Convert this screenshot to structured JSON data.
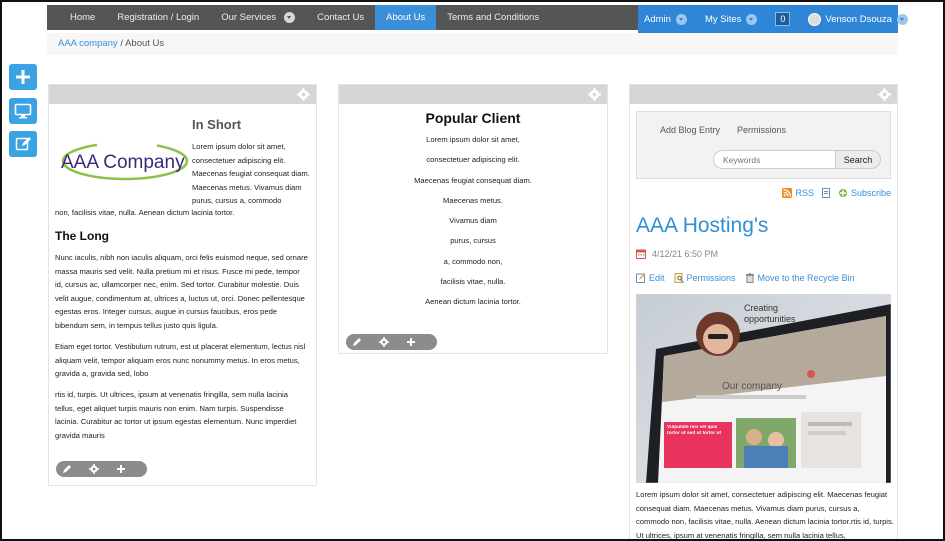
{
  "nav": {
    "items": [
      {
        "label": "Home",
        "active": false,
        "dropdown": false
      },
      {
        "label": "Registration / Login",
        "active": false,
        "dropdown": false
      },
      {
        "label": "Our Services",
        "active": false,
        "dropdown": true
      },
      {
        "label": "Contact Us",
        "active": false,
        "dropdown": false
      },
      {
        "label": "About Us",
        "active": true,
        "dropdown": false
      },
      {
        "label": "Terms and Conditions",
        "active": false,
        "dropdown": false
      }
    ]
  },
  "userbar": {
    "admin_label": "Admin",
    "my_sites_label": "My Sites",
    "notification_count": "0",
    "user_name": "Venson Dsouza"
  },
  "breadcrumb": {
    "home_label": "AAA company",
    "separator": "/",
    "current_label": "About Us"
  },
  "tools": [
    {
      "name": "add-icon"
    },
    {
      "name": "desktop-icon"
    },
    {
      "name": "edit-icon"
    }
  ],
  "pane1": {
    "logo_text": "AAA Company",
    "short_heading": "In Short",
    "short_text": "Lorem ipsum dolor sit amet, consectetuer adipiscing elit. Maecenas feugiat consequat diam. Maecenas metus. Vivamus diam purus, cursus a, commodo",
    "short_text_tail": "non, facilisis vitae, nulla. Aenean dictum lacinia tortor.",
    "long_heading": "The Long",
    "long_p1": "Nunc iaculis, nibh non iaculis aliquam, orci felis euismod neque, sed ornare massa mauris sed velit. Nulla pretium mi et risus. Fusce mi pede, tempor id, cursus ac, ullamcorper nec, enim. Sed tortor. Curabitur molestie. Duis velit augue, condimentum at, ultrices a, luctus ut, orci. Donec pellentesque egestas eros. Integer cursus, augue in cursus faucibus, eros pede bibendum sem, in tempus tellus justo quis ligula.",
    "long_p2": "Etiam eget tortor. Vestibulum rutrum, est ut placerat elementum, lectus nisl aliquam velit, tempor aliquam eros nunc nonummy metus. In eros metus, gravida a, gravida sed, lobo",
    "long_p3": "rtis id, turpis. Ut ultrices, ipsum at venenatis fringilla, sem nulla lacinia tellus, eget aliquet turpis mauris non enim. Nam turpis. Suspendisse lacinia. Curabitur ac tortor ut ipsum egestas elementum. Nunc imperdiet gravida mauris"
  },
  "pane2": {
    "heading": "Popular Client",
    "lines": [
      "Lorem ipsum dolor sit amet,",
      "consectetuer adipiscing elit.",
      "Maecenas feugiat consequat diam.",
      "Maecenas metus.",
      "Vivamus diam",
      "purus, cursus",
      "a, commodo non,",
      "facilisis vitae, nulla.",
      "Aenean dictum lacinia tortor."
    ]
  },
  "pane3": {
    "add_blog_entry": "Add Blog Entry",
    "permissions_tab": "Permissions",
    "search_placeholder": "Keywords",
    "search_button": "Search",
    "rss_label": "RSS",
    "subscribe_label": "Subscribe",
    "post_title": "AAA Hosting's",
    "post_date": "4/12/21 6:50 PM",
    "edit_label": "Edit",
    "permissions_label": "Permissions",
    "recycle_label": "Move to the Recycle Bin",
    "image_text_creating": "Creating",
    "image_text_opportunities": "opportunities",
    "image_text_company": "Our company",
    "image_text_promo": "Vulputate nisi vel quis tortor ut sed ut tortor ut",
    "post_text": "Lorem ipsum dolor sit amet, consectetuer adipiscing elit. Maecenas feugiat consequat diam. Maecenas metus. Vivamus diam purus, cursus a, commodo non, facilisis vitae, nulla. Aenean dictum lacinia tortor.rtis id, turpis. Ut ultrices, ipsum at venenatis fringilla, sem nulla lacinia tellus,"
  },
  "colors": {
    "accent": "#3a8fd9",
    "nav_bg": "#555555",
    "userbar_bg": "#2f86d6",
    "tool_bg": "#3aa3e3",
    "pane_header": "#d6d6d6"
  }
}
